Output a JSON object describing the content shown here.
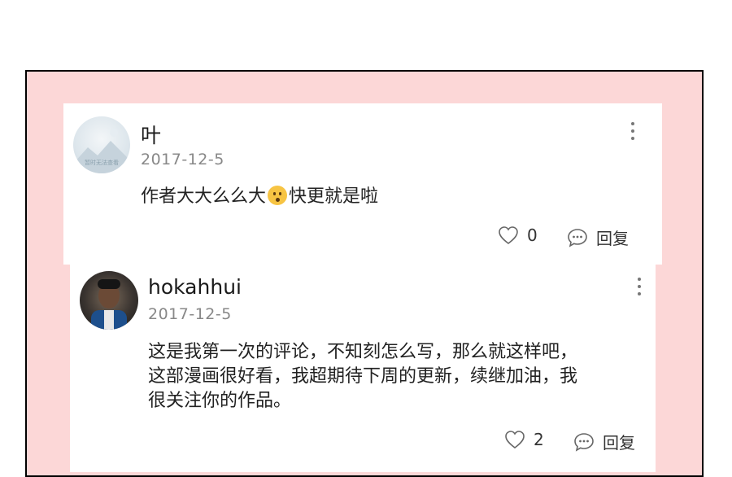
{
  "comments": [
    {
      "author": "叶",
      "date": "2017-12-5",
      "text_before": "作者大大么么大",
      "emoji": "kissing-face",
      "text_after": "快更就是啦",
      "avatar_caption": "暂时无法查看",
      "likes": "0",
      "reply_label": "回复"
    },
    {
      "author": "hokahhui",
      "date": "2017-12-5",
      "lines": [
        "这是我第一次的评论，不知刻怎么写，那么就这样吧，",
        "这部漫画很好看，我超期待下周的更新，续继加油，我",
        "很关注你的作品。"
      ],
      "likes": "2",
      "reply_label": "回复"
    }
  ],
  "colors": {
    "frame_bg": "#fcd7d7",
    "card_bg": "#ffffff",
    "date": "#888888"
  }
}
